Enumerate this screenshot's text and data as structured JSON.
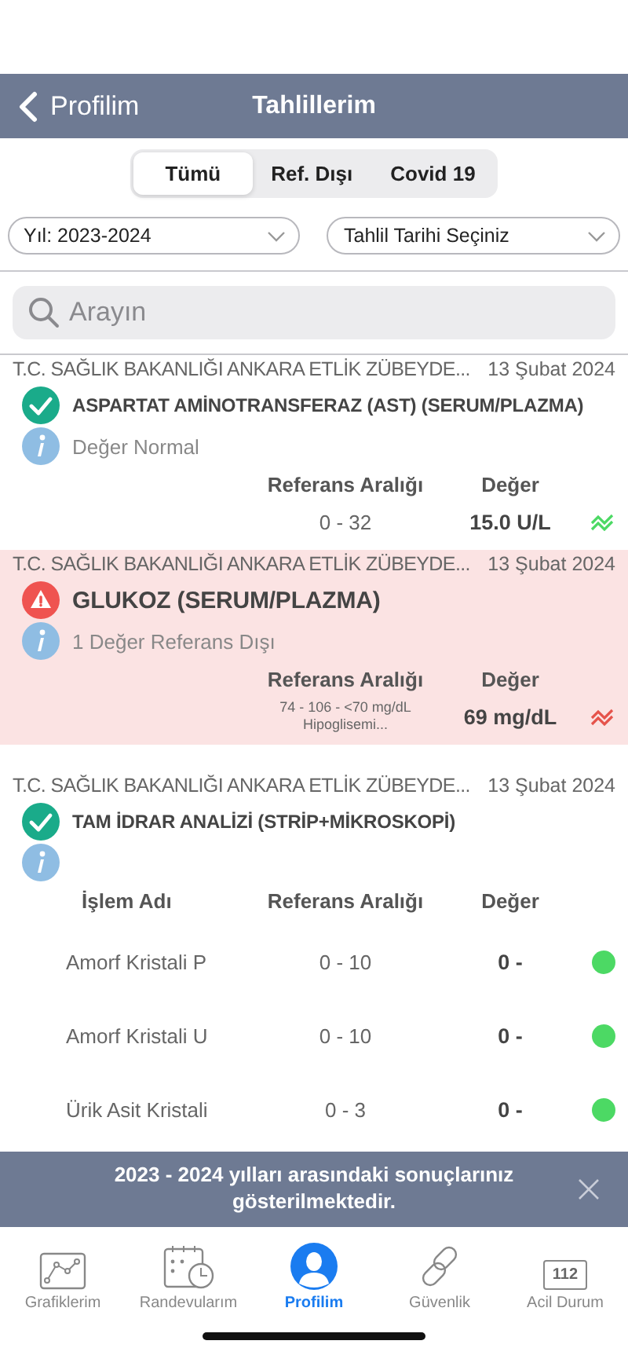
{
  "nav": {
    "back_label": "Profilim",
    "title": "Tahlillerim"
  },
  "segments": [
    {
      "label": "Tümü",
      "selected": true
    },
    {
      "label": "Ref. Dışı",
      "selected": false
    },
    {
      "label": "Covid 19",
      "selected": false
    }
  ],
  "filters": [
    {
      "value": "Yıl: 2023-2024"
    },
    {
      "value": "Tahlil Tarihi Seçiniz"
    }
  ],
  "search": {
    "placeholder": "Arayın"
  },
  "results": [
    {
      "institution": "T.C. SAĞLIK BAKANLIĞI ANKARA ETLİK ZÜBEYDE...",
      "date": "13 Şubat 2024",
      "kind": "normal",
      "title": "ASPARTAT AMİNOTRANSFERAZ (AST) (SERUM/PLAZMA)",
      "info": "Değer Normal",
      "columns": [
        "Referans Aralığı",
        "Değer"
      ],
      "rows": [
        {
          "reference": [
            "0 - 32"
          ],
          "value": "15.0 U/L",
          "kind": "trend",
          "color": "#4cd964"
        }
      ]
    },
    {
      "institution": "T.C. SAĞLIK BAKANLIĞI ANKARA ETLİK ZÜBEYDE...",
      "date": "13 Şubat 2024",
      "kind": "alert",
      "title": "GLUKOZ (SERUM/PLAZMA)",
      "info": "1 Değer Referans Dışı",
      "columns": [
        "Referans Aralığı",
        "Değer"
      ],
      "rows": [
        {
          "reference": [
            "74 - 106  - <70 mg/dL",
            "Hipoglisemi..."
          ],
          "value": "69 mg/dL",
          "kind": "trend",
          "color": "#e5534b"
        }
      ]
    },
    {
      "institution": "T.C. SAĞLIK BAKANLIĞI ANKARA ETLİK ZÜBEYDE...",
      "date": "13 Şubat 2024",
      "kind": "normal",
      "title": "TAM İDRAR ANALİZİ (STRİP+MİKROSKOPİ)",
      "columns": [
        "İşlem Adı",
        "Referans Aralığı",
        "Değer"
      ],
      "rows": [
        {
          "name": "Amorf Kristali P",
          "reference": [
            "0 - 10"
          ],
          "value": "0 -",
          "kind": "dot",
          "color": "#4cd964"
        },
        {
          "name": "Amorf Kristali U",
          "reference": [
            "0 - 10"
          ],
          "value": "0 -",
          "kind": "dot",
          "color": "#4cd964"
        },
        {
          "name": "Ürik Asit Kristali",
          "reference": [
            "0 - 3"
          ],
          "value": "0 -",
          "kind": "dot",
          "color": "#4cd964"
        }
      ]
    }
  ],
  "banner": {
    "text": "2023 - 2024 yılları arasındaki sonuçlarınız gösterilmektedir."
  },
  "tabbar": [
    {
      "kind": "chart",
      "label": "Grafiklerim",
      "selected": false
    },
    {
      "kind": "calendar",
      "label": "Randevularım",
      "selected": false
    },
    {
      "kind": "profile",
      "label": "Profilim",
      "selected": true
    },
    {
      "kind": "link",
      "label": "Güvenlik",
      "selected": false
    },
    {
      "kind": "emergency",
      "label": "Acil Durum",
      "badge": "112",
      "selected": false
    }
  ]
}
